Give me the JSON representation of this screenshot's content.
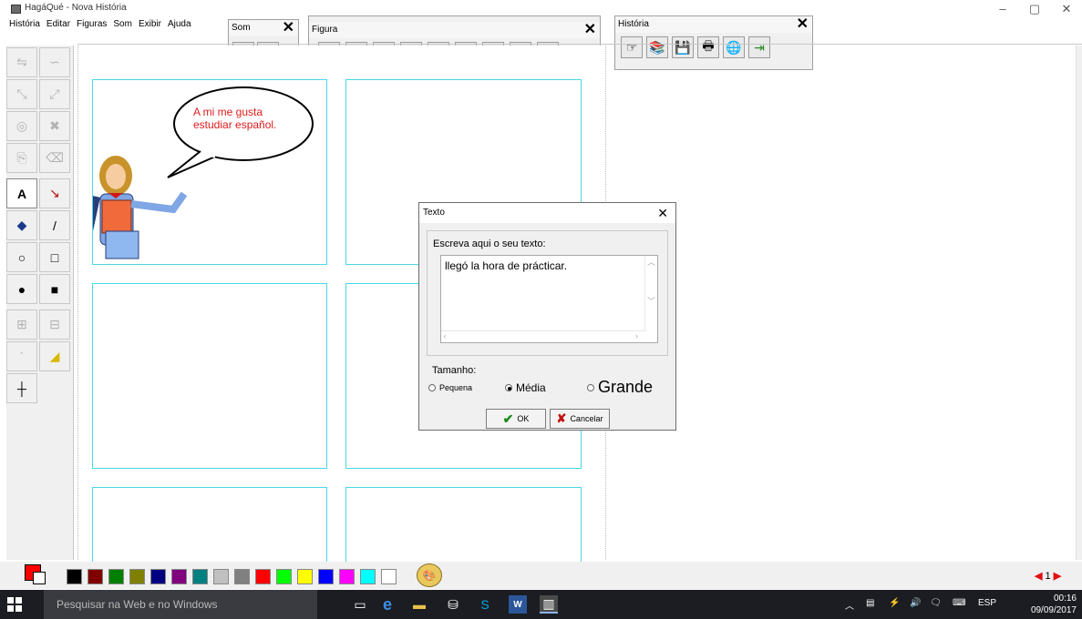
{
  "window": {
    "title": "HagáQué - Nova História"
  },
  "menu": [
    "História",
    "Editar",
    "Figuras",
    "Som",
    "Exibir",
    "Ajuda"
  ],
  "toolbars": {
    "som": {
      "title": "Som",
      "close": "✕"
    },
    "figura": {
      "title": "Figura",
      "close": "✕"
    },
    "historia": {
      "title": "História",
      "close": "✕"
    }
  },
  "comic": {
    "speech": "A  mi me gusta estudiar español."
  },
  "dialog": {
    "title": "Texto",
    "close": "✕",
    "group_label": "Escreva aqui o seu texto:",
    "text_value": "llegó la hora de prácticar.",
    "size_label": "Tamanho:",
    "sizes": {
      "small": "Pequena",
      "medium": "Média",
      "large": "Grande"
    },
    "selected_size": "Média",
    "ok_label": "OK",
    "cancel_label": "Cancelar"
  },
  "palette": {
    "colors": [
      "#000000",
      "#800000",
      "#008000",
      "#808000",
      "#000080",
      "#800080",
      "#008080",
      "#c0c0c0",
      "#808080",
      "#ff0000",
      "#00ff00",
      "#ffff00",
      "#0000ff",
      "#ff00ff",
      "#00ffff",
      "#ffffff"
    ],
    "current_color": "#ff0000",
    "page_number": "1"
  },
  "taskbar": {
    "search_placeholder": "Pesquisar na Web e no Windows",
    "language": "ESP",
    "time": "00:16",
    "date": "09/09/2017"
  }
}
